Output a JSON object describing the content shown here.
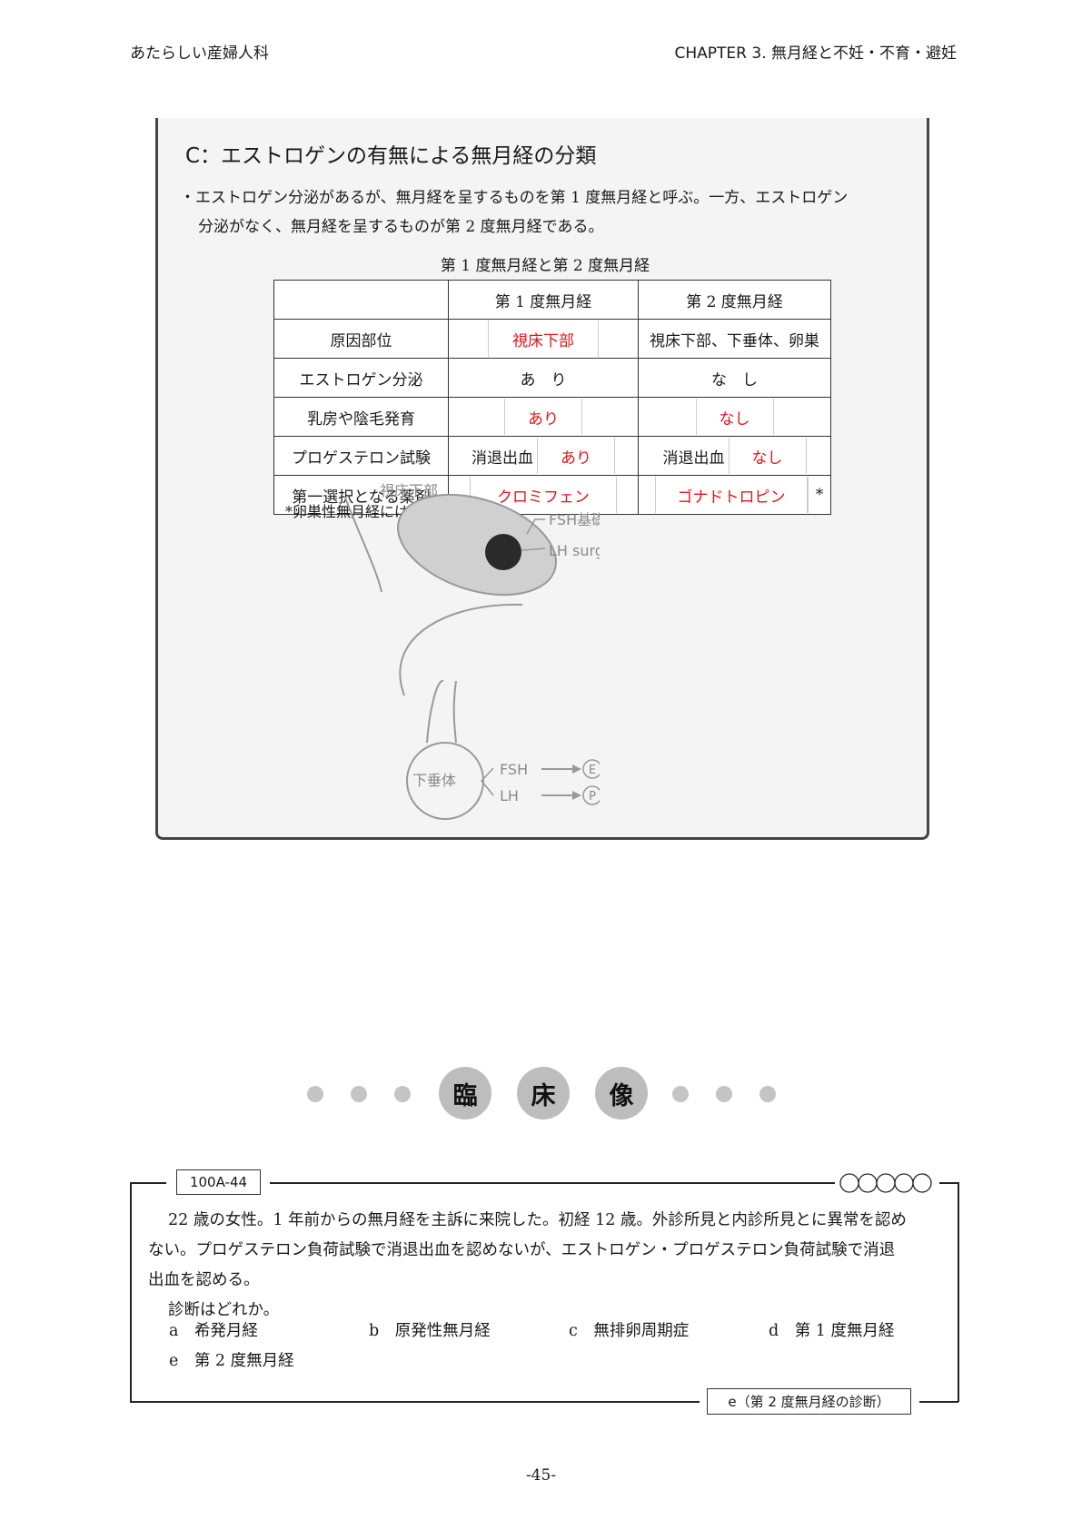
{
  "header": {
    "left": "あたらしい産婦人科",
    "right": "CHAPTER 3. 無月経と不妊・不育・避妊"
  },
  "section": {
    "title": "C：エストロゲンの有無による無月経の分類",
    "text_line1": "・エストロゲン分泌があるが、無月経を呈するものを第 1 度無月経と呼ぶ。一方、エストロゲン",
    "text_line2": "分泌がなく、無月経を呈するものが第 2 度無月経である。",
    "table_caption": "第 1 度無月経と第 2 度無月経",
    "table": {
      "col1": "第 1 度無月経",
      "col2": "第 2 度無月経",
      "rows": {
        "cause": {
          "label": "原因部位",
          "deg1": "視床下部",
          "deg2": "視床下部、下垂体、卵巣"
        },
        "estrogen": {
          "label": "エストロゲン分泌",
          "deg1": "あ　り",
          "deg2": "な　し"
        },
        "breast": {
          "label": "乳房や陰毛発育",
          "deg1": "あり",
          "deg2": "なし"
        },
        "progesterone": {
          "label": "プロゲステロン試験",
          "deg1_prefix": "消退出血",
          "deg1": "あり",
          "deg2_prefix": "消退出血",
          "deg2": "なし"
        },
        "drug": {
          "label": "第一選択となる薬剤",
          "deg1": "クロミフェン",
          "deg2": "ゴナドトロピン",
          "deg2_mark": "*"
        }
      }
    },
    "footnote": "*卵巣性無月経には無効。",
    "diagram": {
      "hypothalamus": "視床下部",
      "fsh_center": "FSH基礎分泌担当部",
      "lh_center": "LH surge担当部",
      "pituitary": "下垂体",
      "fsh": "FSH",
      "lh": "LH",
      "e": "E",
      "p": "P"
    }
  },
  "banner": {
    "c1": "臨",
    "c2": "床",
    "c3": "像"
  },
  "question": {
    "id": "100A-44",
    "stars": "○○○○○",
    "stem_line1": "22 歳の女性。1 年前からの無月経を主訴に来院した。初経 12 歳。外診所見と内診所見とに異常を認め",
    "stem_line2": "ない。プロゲステロン負荷試験で消退出血を認めないが、エストロゲン・プロゲステロン負荷試験で消退",
    "stem_line3": "出血を認める。",
    "prompt": "診断はどれか。",
    "choices": [
      {
        "letter": "a",
        "text": "希発月経"
      },
      {
        "letter": "b",
        "text": "原発性無月経"
      },
      {
        "letter": "c",
        "text": "無排卵周期症"
      },
      {
        "letter": "d",
        "text": "第 1 度無月経"
      },
      {
        "letter": "e",
        "text": "第 2 度無月経"
      }
    ],
    "answer": "e（第 2 度無月経の診断）"
  },
  "page_number": "-45-"
}
